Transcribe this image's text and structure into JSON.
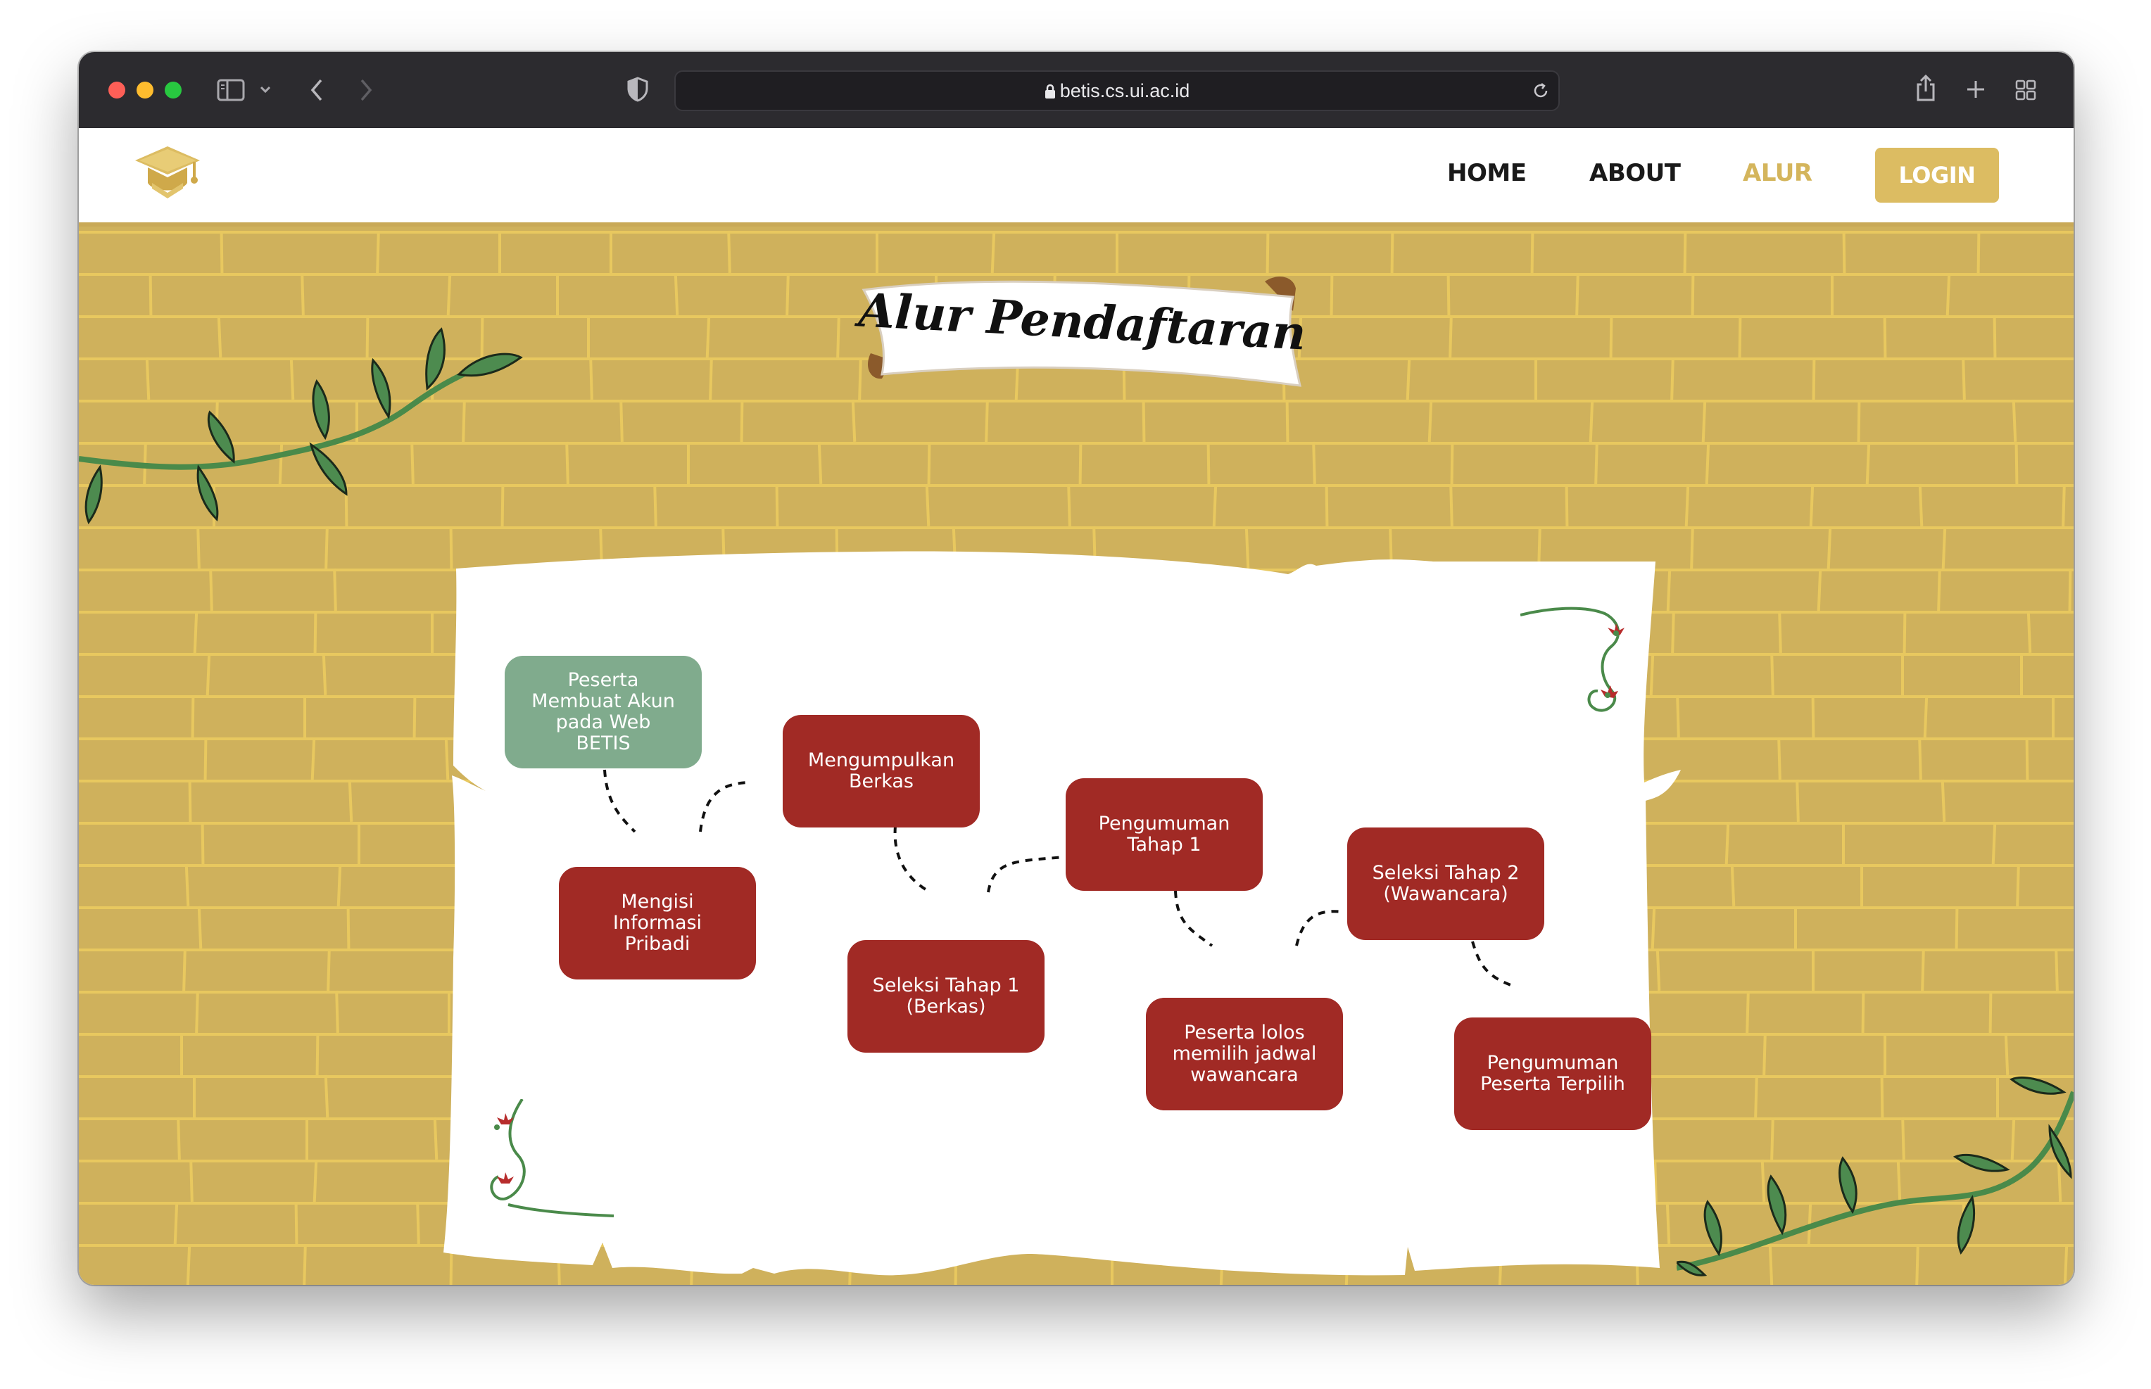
{
  "browser": {
    "url": "betis.cs.ui.ac.id",
    "icons": [
      "sidebar-icon",
      "chevron-down-icon",
      "back-icon",
      "forward-icon",
      "shield-icon",
      "lock-icon",
      "reload-icon",
      "share-icon",
      "new-tab-icon",
      "tab-overview-icon"
    ]
  },
  "nav": {
    "logo_icon": "graduation-cap-icon",
    "links": [
      "HOME",
      "ABOUT",
      "ALUR"
    ],
    "active": "ALUR",
    "login": "LOGIN"
  },
  "page": {
    "title": "Alur Pendaftaran"
  },
  "steps": [
    "Peserta\nMembuat Akun\npada Web\nBETIS",
    "Mengisi\nInformasi\nPribadi",
    "Mengumpulkan\nBerkas",
    "Seleksi Tahap 1\n(Berkas)",
    "Pengumuman\nTahap 1",
    "Peserta lolos\nmemilih jadwal\nwawancara",
    "Seleksi Tahap 2\n(Wawancara)",
    "Pengumuman\nPeserta Terpilih"
  ],
  "colors": {
    "wall": "#cfb15c",
    "brick_line": "#e8c85f",
    "step_red": "#a12a25",
    "step_green": "#80ab8d",
    "accent_gold": "#dcbc62",
    "leaf_green": "#4a8a4a"
  }
}
